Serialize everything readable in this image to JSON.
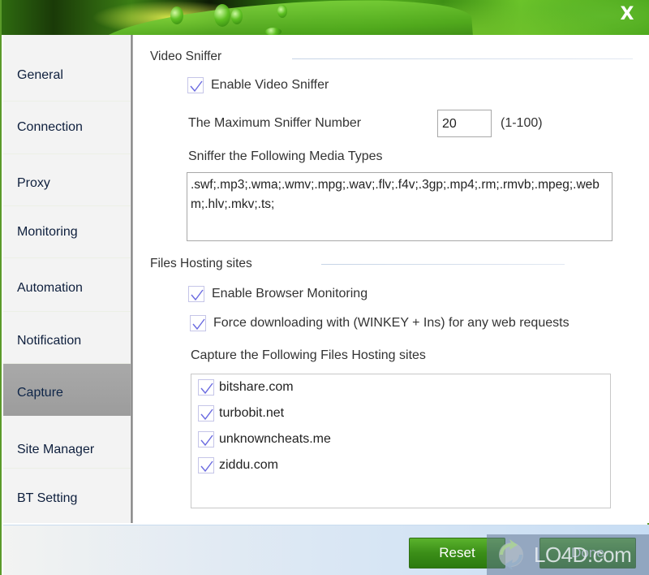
{
  "window": {
    "close_label": "X"
  },
  "sidebar": {
    "items": [
      {
        "label": "General",
        "active": false
      },
      {
        "label": "Connection",
        "active": false
      },
      {
        "label": "Proxy",
        "active": false
      },
      {
        "label": "Monitoring",
        "active": false
      },
      {
        "label": "Automation",
        "active": false
      },
      {
        "label": "Notification",
        "active": false
      },
      {
        "label": "Capture",
        "active": true
      },
      {
        "label": "Site Manager",
        "active": false
      },
      {
        "label": "BT Setting",
        "active": false
      }
    ]
  },
  "video_sniffer": {
    "title": "Video Sniffer",
    "enable_label": "Enable Video Sniffer",
    "enable_checked": true,
    "max_number_label": "The Maximum Sniffer Number",
    "max_number_value": "20",
    "max_number_range": "(1-100)",
    "media_types_label": "Sniffer the Following Media Types",
    "media_types_value": ".swf;.mp3;.wma;.wmv;.mpg;.wav;.flv;.f4v;.3gp;.mp4;.rm;.rmvb;.mpeg;.webm;.hlv;.mkv;.ts;"
  },
  "files_hosting": {
    "title": "Files Hosting sites",
    "browser_monitoring_label": "Enable Browser Monitoring",
    "browser_monitoring_checked": true,
    "force_download_label": "Force downloading with (WINKEY + Ins) for any web requests",
    "force_download_checked": true,
    "capture_label": "Capture the Following Files Hosting sites",
    "sites": [
      {
        "name": "bitshare.com",
        "checked": true
      },
      {
        "name": "turbobit.net",
        "checked": true
      },
      {
        "name": "unknowncheats.me",
        "checked": true
      },
      {
        "name": "ziddu.com",
        "checked": true
      }
    ]
  },
  "footer": {
    "reset_label": "Reset",
    "done_label": "Done"
  },
  "watermark": {
    "text": "LO4D.com"
  },
  "colors": {
    "accent_green": "#3b8e18",
    "active_tab": "#a3a3a3",
    "checkmark": "#6a6ae0"
  }
}
